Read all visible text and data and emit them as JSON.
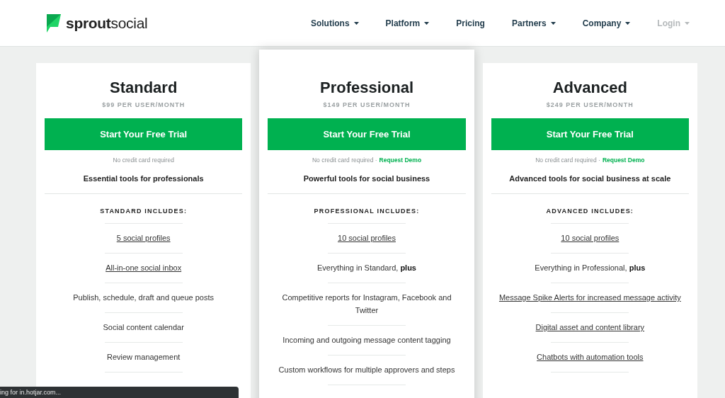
{
  "header": {
    "logo": {
      "bold": "sprout",
      "light": "social"
    },
    "nav": [
      {
        "label": "Solutions",
        "dropdown": true,
        "disabled": false
      },
      {
        "label": "Platform",
        "dropdown": true,
        "disabled": false
      },
      {
        "label": "Pricing",
        "dropdown": false,
        "disabled": false
      },
      {
        "label": "Partners",
        "dropdown": true,
        "disabled": false
      },
      {
        "label": "Company",
        "dropdown": true,
        "disabled": false
      },
      {
        "label": "Login",
        "dropdown": true,
        "disabled": true
      }
    ]
  },
  "plans": [
    {
      "name": "Standard",
      "price": "$99 PER USER/MONTH",
      "featured": false,
      "button": "Start Your Free Trial",
      "note": "No credit card required",
      "tagline": "Essential tools for professionals",
      "includes": "STANDARD INCLUDES:",
      "features": [
        {
          "kind": "link",
          "text": "5 social profiles"
        },
        {
          "kind": "link",
          "text": "All-in-one social inbox"
        },
        {
          "kind": "text",
          "text": "Publish, schedule, draft and queue posts"
        },
        {
          "kind": "text",
          "text": "Social content calendar"
        },
        {
          "kind": "text",
          "text": "Review management"
        }
      ]
    },
    {
      "name": "Professional",
      "price": "$149 PER USER/MONTH",
      "featured": true,
      "button": "Start Your Free Trial",
      "note": "No credit card required ·",
      "demo_link": "Request Demo",
      "tagline": "Powerful tools for social business",
      "includes": "PROFESSIONAL INCLUDES:",
      "features": [
        {
          "kind": "link",
          "text": "10 social profiles"
        },
        {
          "kind": "text",
          "text": "Everything in Standard, **plus**"
        },
        {
          "kind": "text",
          "text": "Competitive reports for Instagram, Facebook and Twitter"
        },
        {
          "kind": "text",
          "text": "Incoming and outgoing message content tagging"
        },
        {
          "kind": "text",
          "text": "Custom workflows for multiple approvers and steps"
        }
      ]
    },
    {
      "name": "Advanced",
      "price": "$249 PER USER/MONTH",
      "featured": false,
      "button": "Start Your Free Trial",
      "note": "No credit card required ·",
      "demo_link": "Request Demo",
      "tagline": "Advanced tools for social business at scale",
      "includes": "ADVANCED INCLUDES:",
      "features": [
        {
          "kind": "link",
          "text": "10 social profiles"
        },
        {
          "kind": "text",
          "text": "Everything in Professional, **plus**"
        },
        {
          "kind": "link",
          "text": "Message Spike Alerts for increased message activity"
        },
        {
          "kind": "link",
          "text": "Digital asset and content library"
        },
        {
          "kind": "link",
          "text": "Chatbots with automation tools"
        }
      ]
    }
  ],
  "status_bar": {
    "text": "ing for in.hotjar.com..."
  }
}
